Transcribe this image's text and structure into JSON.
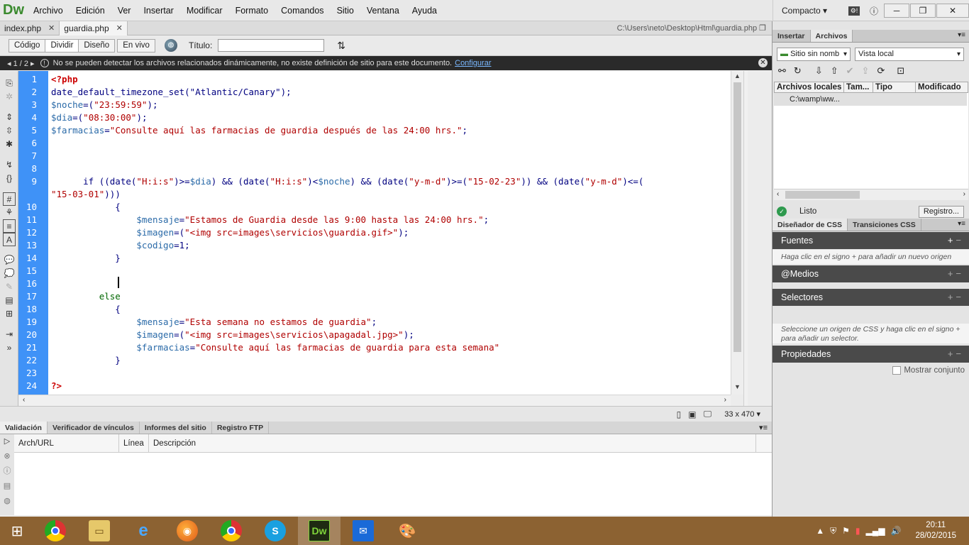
{
  "app": {
    "logo": "Dw",
    "menu": [
      "Archivo",
      "Edición",
      "Ver",
      "Insertar",
      "Modificar",
      "Formato",
      "Comandos",
      "Sitio",
      "Ventana",
      "Ayuda"
    ],
    "workspace": "Compacto",
    "workspace_caret": "▾"
  },
  "tabs": {
    "items": [
      {
        "label": "index.php"
      },
      {
        "label": "guardia.php"
      }
    ],
    "path": "C:\\Users\\neto\\Desktop\\Html\\guardia.php"
  },
  "viewbar": {
    "buttons": [
      "Código",
      "Dividir",
      "Diseño",
      "En vivo"
    ],
    "title_label": "Título:",
    "title_value": ""
  },
  "infobar": {
    "pager": "1 / 2",
    "message": "No se pueden detectar los archivos relacionados dinámicamente, no existe definición de sitio para este documento.",
    "link": "Configurar"
  },
  "editor": {
    "line_numbers": [
      "1",
      "2",
      "3",
      "4",
      "5",
      "6",
      "7",
      "8",
      "9",
      "10",
      "11",
      "12",
      "13",
      "14",
      "15",
      "16",
      "17",
      "18",
      "19",
      "20",
      "21",
      "22",
      "23",
      "24"
    ],
    "lines": {
      "l1": "<?php",
      "l2": "date_default_timezone_set(\"Atlantic/Canary\");",
      "l3a": "$noche",
      "l3b": "=(",
      "l3c": "\"23:59:59\"",
      "l3d": ");",
      "l4a": "$dia",
      "l4b": "=(",
      "l4c": "\"08:30:00\"",
      "l4d": ");",
      "l5a": "$farmacias",
      "l5b": "=",
      "l5c": "\"Consulte aquí las farmacias de guardia después de las 24:00 hrs.\"",
      "l5d": ";",
      "l9a": "      if ((date(",
      "l9b": "\"H:i:s\"",
      "l9c": ")>=",
      "l9d": "$dia",
      "l9e": ") && (date(",
      "l9f": "\"H:i:s\"",
      "l9g": ")<",
      "l9h": "$noche",
      "l9i": ") && (date(",
      "l9j": "\"y-m-d\"",
      "l9k": ")>=(",
      "l9l": "\"15-02-23\"",
      "l9m": ")) && (date(",
      "l9n": "\"y-m-d\"",
      "l9o": ")<=(",
      "l9wrap": "\"15-03-01\"",
      "l9wrap2": ")))",
      "l10": "            {",
      "l11a": "                $mensaje",
      "l11b": "=",
      "l11c": "\"Estamos de Guardia desde las 9:00 hasta las 24:00 hrs.\"",
      "l11d": ";",
      "l12a": "                $imagen",
      "l12b": "=(",
      "l12c": "\"<img src=images\\servicios\\guardia.gif>\"",
      "l12d": ");",
      "l13a": "                $codigo",
      "l13b": "=1;",
      "l14": "            }",
      "l17": "         else",
      "l18": "            {",
      "l19a": "                $mensaje",
      "l19b": "=",
      "l19c": "\"Esta semana no estamos de guardia\"",
      "l19d": ";",
      "l20a": "                $imagen",
      "l20b": "=(",
      "l20c": "\"<img src=images\\servicios\\apagadal.jpg>\"",
      "l20d": ");",
      "l21a": "                $farmacias",
      "l21b": "=",
      "l21c": "\"Consulte aquí las farmacias de guardia para esta semana\"",
      "l21d": "",
      "l22": "            }",
      "l24": "?>"
    }
  },
  "statusbar": {
    "dimensions": "33 x 470",
    "dim_caret": "▾"
  },
  "bottom_panel": {
    "tabs": [
      "Validación",
      "Verificador de vínculos",
      "Informes del sitio",
      "Registro FTP"
    ],
    "columns": [
      "Arch/URL",
      "Línea",
      "Descripción"
    ]
  },
  "right_panel": {
    "tabs": [
      "Insertar",
      "Archivos"
    ],
    "site_select": "Sitio sin nomb",
    "view_select": "Vista local",
    "file_columns": [
      "Archivos locales",
      "Tam...",
      "Tipo",
      "Modificado"
    ],
    "file_row": "C:\\wamp\\ww...",
    "status": "Listo",
    "log_button": "Registro...",
    "css_tabs": [
      "Diseñador de CSS",
      "Transiciones CSS"
    ],
    "sources_title": "Fuentes",
    "sources_hint": "Haga clic en el signo + para añadir un nuevo origen",
    "media_title": "@Medios",
    "selectors_title": "Selectores",
    "selectors_hint": "Seleccione un origen de CSS y haga clic en el signo + para añadir un selector.",
    "properties_title": "Propiedades",
    "show_set": "Mostrar conjunto"
  },
  "taskbar": {
    "time": "20:11",
    "date": "28/02/2015"
  }
}
